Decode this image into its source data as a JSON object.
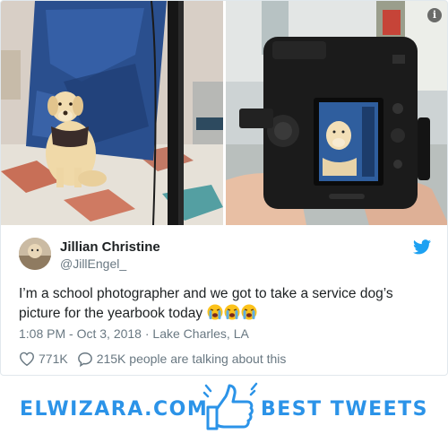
{
  "tweet": {
    "author_name": "Jillian Christine",
    "author_handle": "@JillEngel_",
    "text": "I’m a school photographer and we got to take a service dog’s picture for the yearbook today",
    "emojis": [
      "loudly-crying-face",
      "loudly-crying-face",
      "loudly-crying-face"
    ],
    "timestamp": "1:08 PM - Oct 3, 2018",
    "separator": " · ",
    "location": "Lake Charles, LA",
    "likes": "771K",
    "talking": "215K people are talking about this"
  },
  "icons": {
    "info": "info-icon",
    "twitter": "twitter-bird-icon",
    "like": "heart-icon",
    "reply": "speech-bubble-icon",
    "branding": "thumbs-up-icon"
  },
  "footer": {
    "left_brand": "ELWIZARA.COM",
    "right_brand": "BEST TWEETS"
  },
  "colors": {
    "twitter_blue": "#1da1f2",
    "brand_blue": "#2b93e8",
    "text": "#1c2022",
    "muted": "#697882"
  }
}
